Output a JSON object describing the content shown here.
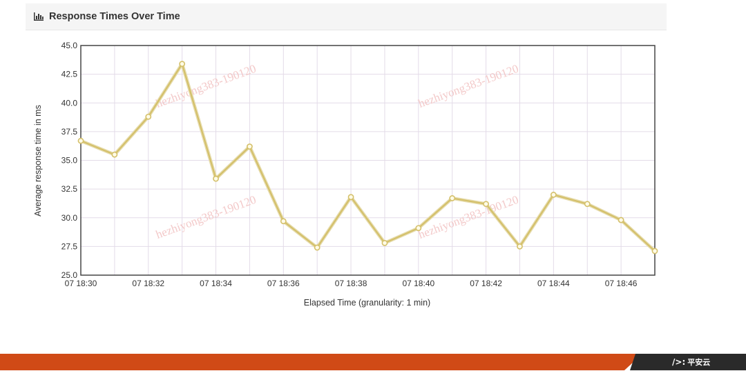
{
  "panel": {
    "title": "Response Times Over Time",
    "icon": "bar-chart-icon"
  },
  "watermark": "hezhiyong383-190120",
  "footer": {
    "brand": "平安云",
    "logo_mark": "/>:",
    "orange": "#d04a16",
    "dark": "#2a2a2a"
  },
  "chart_data": {
    "type": "line",
    "title": "",
    "xlabel": "Elapsed Time (granularity: 1 min)",
    "ylabel": "Average response time in ms",
    "ylim": [
      25.0,
      45.0
    ],
    "yticks": [
      "25.0",
      "27.5",
      "30.0",
      "32.5",
      "35.0",
      "37.5",
      "40.0",
      "42.5",
      "45.0"
    ],
    "xlim": [
      "18:30",
      "18:47"
    ],
    "xticks": [
      "07 18:30",
      "07 18:32",
      "07 18:34",
      "07 18:36",
      "07 18:38",
      "07 18:40",
      "07 18:42",
      "07 18:44",
      "07 18:46"
    ],
    "grid": true,
    "series": [
      {
        "color": "#d4c06a",
        "points": [
          {
            "x": "18:30",
            "y": 36.7
          },
          {
            "x": "18:31",
            "y": 35.5
          },
          {
            "x": "18:32",
            "y": 38.8
          },
          {
            "x": "18:33",
            "y": 43.4
          },
          {
            "x": "18:34",
            "y": 33.4
          },
          {
            "x": "18:35",
            "y": 36.2
          },
          {
            "x": "18:36",
            "y": 29.7
          },
          {
            "x": "18:37",
            "y": 27.4
          },
          {
            "x": "18:38",
            "y": 31.8
          },
          {
            "x": "18:39",
            "y": 27.8
          },
          {
            "x": "18:40",
            "y": 29.1
          },
          {
            "x": "18:41",
            "y": 31.7
          },
          {
            "x": "18:42",
            "y": 31.2
          },
          {
            "x": "18:43",
            "y": 27.5
          },
          {
            "x": "18:44",
            "y": 32.0
          },
          {
            "x": "18:45",
            "y": 31.2
          },
          {
            "x": "18:46",
            "y": 29.8
          },
          {
            "x": "18:47",
            "y": 27.1
          }
        ]
      }
    ]
  }
}
